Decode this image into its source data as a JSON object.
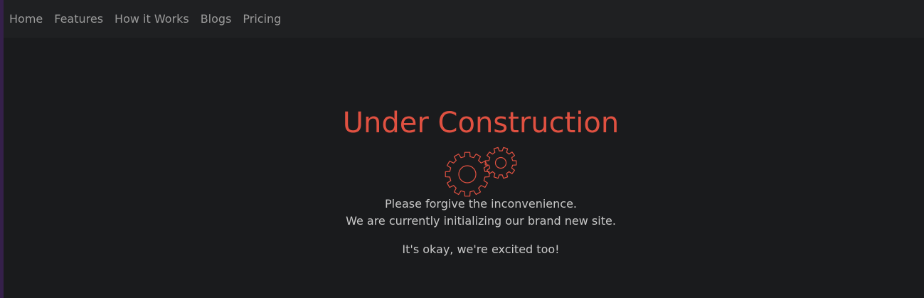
{
  "nav": {
    "items": [
      {
        "label": "Home"
      },
      {
        "label": "Features"
      },
      {
        "label": "How it Works"
      },
      {
        "label": "Blogs"
      },
      {
        "label": "Pricing"
      }
    ]
  },
  "main": {
    "title": "Under Construction",
    "line_1": "Please forgive the inconvenience.",
    "line_2": "We are currently initializing our brand new site.",
    "line_3": "It's okay, we're excited too!",
    "icon": "gears-icon"
  },
  "colors": {
    "background": "#1a1b1d",
    "navbar": "#1f2022",
    "accent": "#e05141",
    "nav_text": "#9a9a9a",
    "body_text": "#c8c8c8",
    "left_bar": "#35204a"
  }
}
